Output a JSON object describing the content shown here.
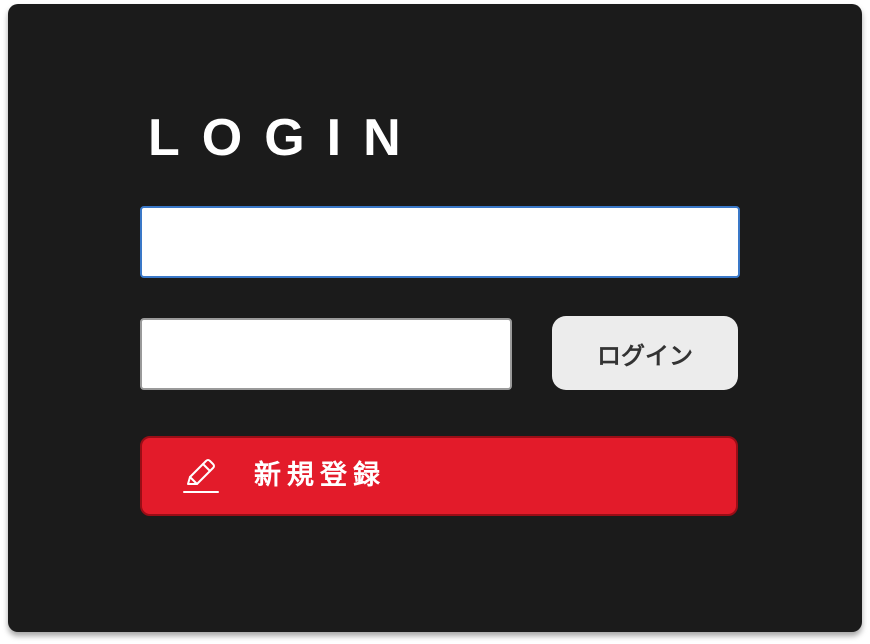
{
  "login_panel": {
    "title": "LOGIN",
    "username_input": {
      "value": "",
      "placeholder": ""
    },
    "password_input": {
      "value": "",
      "placeholder": ""
    },
    "login_button_label": "ログイン",
    "register_button": {
      "label": "新規登録",
      "icon": "pencil-icon"
    }
  },
  "colors": {
    "panel_background": "#1b1b1b",
    "focus_border": "#3a78c8",
    "login_button": "#ececec",
    "register_button": "#e31b2a"
  }
}
